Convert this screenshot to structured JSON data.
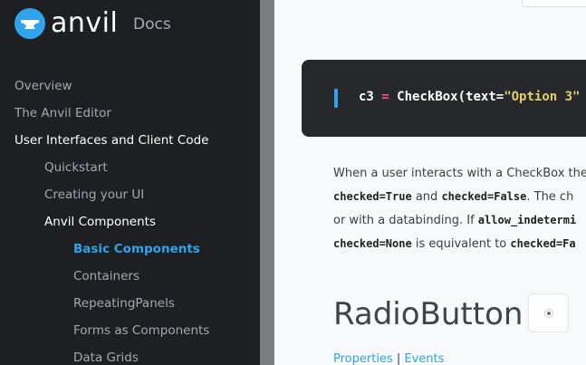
{
  "brand": {
    "wordmark": "anvil",
    "section": "Docs",
    "accent": "#2fa4ec"
  },
  "sidebar": {
    "items": [
      {
        "label": "Overview"
      },
      {
        "label": "The Anvil Editor"
      },
      {
        "label": "User Interfaces and Client Code"
      },
      {
        "label": "Quickstart"
      },
      {
        "label": "Creating your UI"
      },
      {
        "label": "Anvil Components"
      },
      {
        "label": "Basic Components"
      },
      {
        "label": "Containers"
      },
      {
        "label": "RepeatingPanels"
      },
      {
        "label": "Forms as Components"
      },
      {
        "label": "Data Grids"
      }
    ]
  },
  "code": {
    "var": "c3",
    "op": "=",
    "call": "CheckBox(text=",
    "str": "\"Option 3\""
  },
  "paragraph": {
    "l1_text": "When a user interacts with a CheckBox the",
    "l2_code1": "checked=True",
    "l2_and": " and ",
    "l2_code2": "checked=False",
    "l2_rest": ". The ch",
    "l3_text": "or with a databinding. If ",
    "l3_code": "allow_indetermi",
    "l4_code1": "checked=None",
    "l4_mid": " is equivalent to ",
    "l4_code2": "checked=Fa"
  },
  "section": {
    "title": "RadioButton",
    "properties_link": "Properties",
    "separator": " | ",
    "events_link": "Events"
  }
}
